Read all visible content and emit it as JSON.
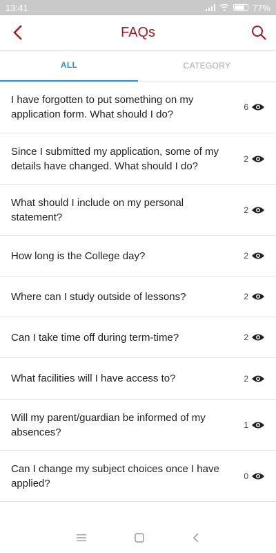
{
  "status": {
    "time": "13:41",
    "battery": "77%"
  },
  "header": {
    "title": "FAQs"
  },
  "tabs": [
    {
      "label": "ALL",
      "active": true
    },
    {
      "label": "CATEGORY",
      "active": false
    }
  ],
  "faqs": [
    {
      "question": "I have forgotten to put something on my application form. What should I do?",
      "views": "6"
    },
    {
      "question": "Since I submitted my application, some of my details have changed. What should I do?",
      "views": "2"
    },
    {
      "question": "What should I include on my personal statement?",
      "views": "2"
    },
    {
      "question": "How long is the College day?",
      "views": "2"
    },
    {
      "question": "Where can I study outside of lessons?",
      "views": "2"
    },
    {
      "question": "Can I take time off during term-time?",
      "views": "2"
    },
    {
      "question": "What facilities will I have access to?",
      "views": "2"
    },
    {
      "question": "Will my parent/guardian be informed of my absences?",
      "views": "1"
    },
    {
      "question": "Can I change my subject choices once I have applied?",
      "views": "0"
    }
  ],
  "colors": {
    "brand": "#9b1b23",
    "accent": "#2f8fd6"
  },
  "icons": {
    "back": "chevron-left-icon",
    "search": "search-icon",
    "views": "eye-icon"
  }
}
